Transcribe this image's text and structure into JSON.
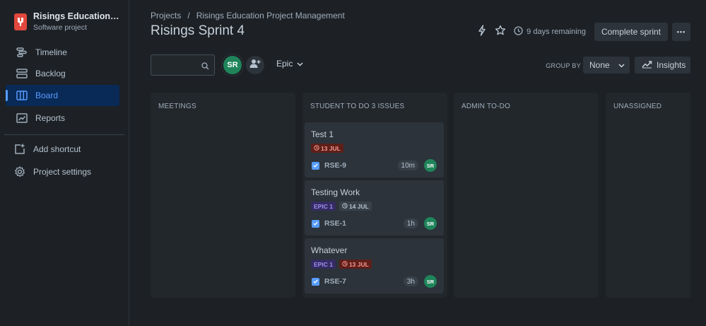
{
  "sidebar": {
    "project_name": "Risings Education Project Management",
    "project_type": "Software project",
    "items": [
      {
        "label": "Timeline"
      },
      {
        "label": "Backlog"
      },
      {
        "label": "Board"
      },
      {
        "label": "Reports"
      },
      {
        "label": "Add shortcut"
      },
      {
        "label": "Project settings"
      }
    ],
    "accent": "#579dff"
  },
  "header": {
    "breadcrumb": [
      "Projects",
      "/",
      "Risings Education Project Management"
    ],
    "title": "Risings Sprint 4",
    "days_remaining": "9 days remaining",
    "complete_label": "Complete sprint",
    "more_label": "•••"
  },
  "toolbar": {
    "search_value": "",
    "avatar_initials": "SR",
    "epic_label": "Epic",
    "groupby_label": "GROUP BY",
    "groupby_value": "None",
    "insights_label": "Insights"
  },
  "board": {
    "columns": [
      {
        "title": "MEETINGS",
        "cards": []
      },
      {
        "title": "STUDENT TO DO 3 ISSUES",
        "cards": [
          {
            "title": "Test 1",
            "epic": "",
            "date": "13 JUL",
            "date_overdue": true,
            "key": "RSE-9",
            "estimate": "10m",
            "assignee": "SR"
          },
          {
            "title": "Testing Work",
            "epic": "EPIC 1",
            "date": "14 JUL",
            "date_overdue": false,
            "key": "RSE-1",
            "estimate": "1h",
            "assignee": "SR"
          },
          {
            "title": "Whatever",
            "epic": "EPIC 1",
            "date": "13 JUL",
            "date_overdue": true,
            "key": "RSE-7",
            "estimate": "3h",
            "assignee": "SR"
          }
        ]
      },
      {
        "title": "ADMIN TO-DO",
        "cards": []
      },
      {
        "title": "UNASSIGNED",
        "cards": []
      }
    ]
  }
}
